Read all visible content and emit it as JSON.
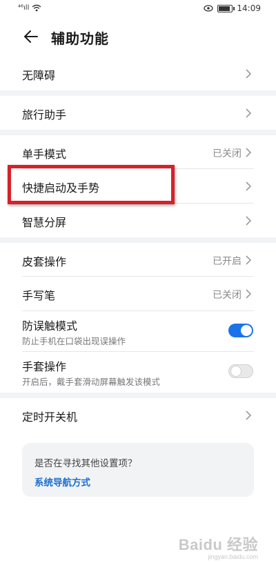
{
  "status_bar": {
    "signal": "⁴⁶ıll",
    "time": "14:09",
    "battery_level": 0.9
  },
  "header": {
    "title": "辅助功能"
  },
  "rows": [
    {
      "label": "无障碍"
    },
    {
      "label": "旅行助手"
    },
    {
      "label": "单手模式",
      "value": "已关闭"
    },
    {
      "label": "快捷启动及手势"
    },
    {
      "label": "智慧分屏"
    },
    {
      "label": "皮套操作",
      "value": "已开启"
    },
    {
      "label": "手写笔",
      "value": "已关闭"
    },
    {
      "label": "防误触模式",
      "sub": "防止手机在口袋出现误操作",
      "toggle": true
    },
    {
      "label": "手套操作",
      "sub": "开启后，戴手套滑动屏幕触发该模式",
      "toggle": false
    },
    {
      "label": "定时开关机"
    }
  ],
  "suggestion": {
    "question": "是否在寻找其他设置项？",
    "link": "系统导航方式"
  },
  "watermark": {
    "brand": "Baidu 经验",
    "url": "jingyan.baidu.com"
  },
  "colors": {
    "accent": "#1a73e8",
    "highlight": "#d8202a",
    "link": "#1a6fd1"
  }
}
